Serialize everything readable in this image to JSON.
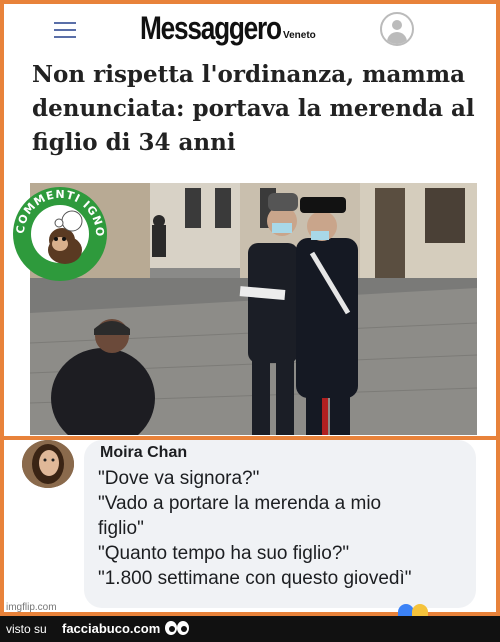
{
  "header": {
    "logo_main": "Messaggero",
    "logo_sub": "Veneto",
    "menu_icon": "hamburger-menu-icon",
    "profile_icon": "user-profile-icon"
  },
  "article": {
    "headline": "Non rispetta l'ordinanza, mamma denunciata: portava la merenda al figlio di 34 anni"
  },
  "badge": {
    "text": "COMMENTI IGNORANTI",
    "icon": "monkey-thinking-icon"
  },
  "comment": {
    "author": "Moira Chan",
    "lines": [
      "\"Dove va signora?\"",
      "\"Vado a portare la merenda a mio",
      "figlio\"",
      "\"Quanto tempo ha suo figlio?\"",
      "\"1.800 settimane con questo giovedì\""
    ]
  },
  "watermark": "imgflip.com",
  "footer": {
    "prefix": "visto su",
    "site": "facciabuco.com",
    "eyes_icon": "eyes-icon"
  },
  "colors": {
    "frame": "#e8823a",
    "badge_green": "#2e9a3c",
    "footer_bg": "#111111",
    "bubble_bg": "#f0f2f5"
  }
}
